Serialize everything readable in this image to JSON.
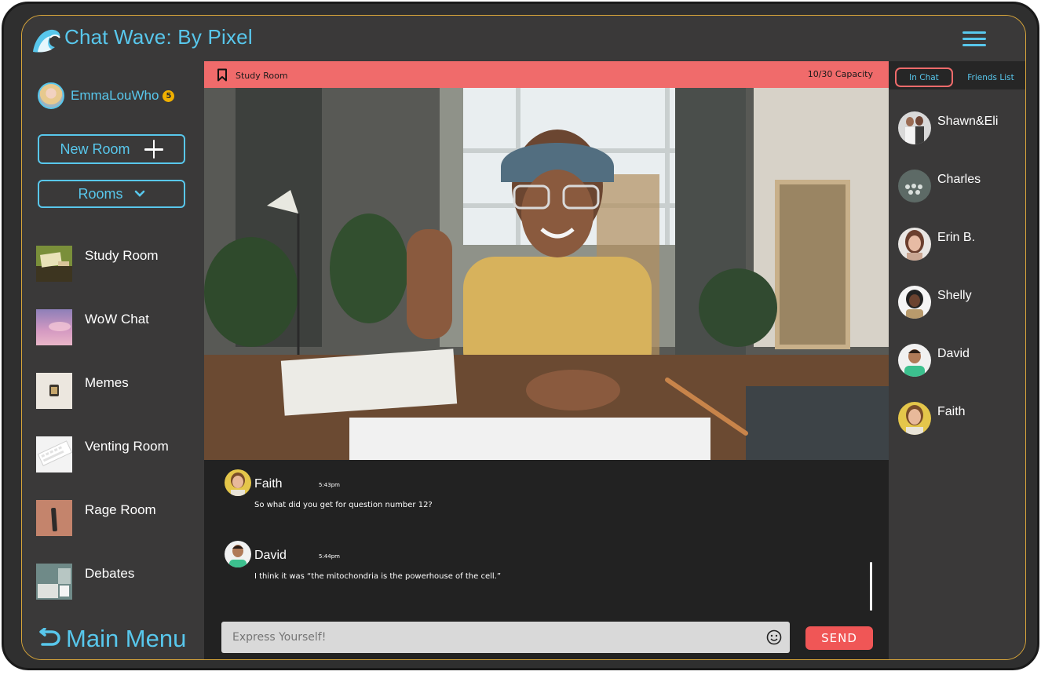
{
  "app": {
    "title": "Chat Wave: By Pixel",
    "logo_icon": "wave-icon",
    "accent_color": "#58c7ec",
    "alert_color": "#f06b6b"
  },
  "user": {
    "name": "EmmaLouWho",
    "badge_count": "5"
  },
  "sidebar": {
    "new_room_label": "New Room",
    "rooms_label": "Rooms",
    "rooms": [
      {
        "label": "Study Room"
      },
      {
        "label": "WoW Chat"
      },
      {
        "label": "Memes"
      },
      {
        "label": "Venting Room"
      },
      {
        "label": "Rage Room"
      },
      {
        "label": "Debates"
      }
    ],
    "main_menu_label": "Main Menu"
  },
  "room": {
    "name": "Study Room",
    "capacity": "10/30 Capacity"
  },
  "messages": [
    {
      "author": "Faith",
      "time": "5:43pm",
      "text": "So what did you get for question number 12?"
    },
    {
      "author": "David",
      "time": "5:44pm",
      "text": "I think it was “the mitochondria is the powerhouse of the cell.”"
    }
  ],
  "composer": {
    "placeholder": "Express Yourself!",
    "send_label": "SEND"
  },
  "right_panel": {
    "tabs": [
      {
        "label": "In Chat"
      },
      {
        "label": "Friends List"
      }
    ],
    "members": [
      {
        "name": "Shawn&Eli"
      },
      {
        "name": "Charles"
      },
      {
        "name": "Erin B."
      },
      {
        "name": "Shelly"
      },
      {
        "name": "David"
      },
      {
        "name": "Faith"
      }
    ]
  }
}
